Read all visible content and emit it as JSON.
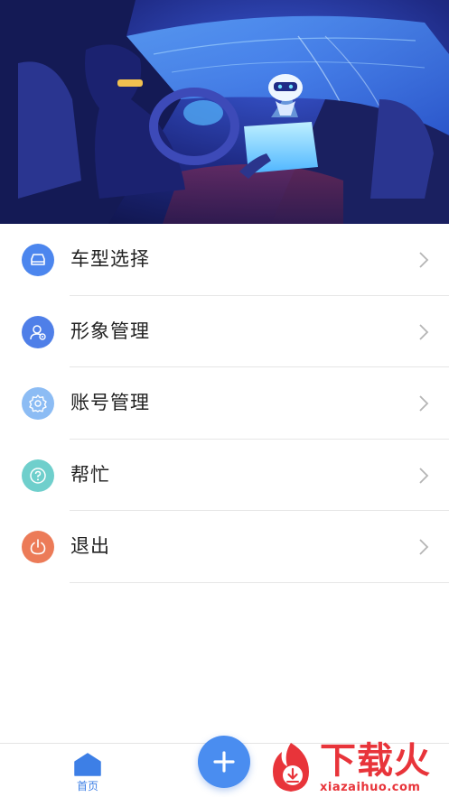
{
  "menu": {
    "items": [
      {
        "label": "车型选择",
        "icon": "car-icon",
        "color": "#4c86ee"
      },
      {
        "label": "形象管理",
        "icon": "avatar-settings-icon",
        "color": "#4f7fe8"
      },
      {
        "label": "账号管理",
        "icon": "gear-icon",
        "color": "#8cbcf4"
      },
      {
        "label": "帮忙",
        "icon": "help-icon",
        "color": "#6fcfcc"
      },
      {
        "label": "退出",
        "icon": "power-icon",
        "color": "#ec7b58"
      }
    ]
  },
  "tabbar": {
    "home_label": "首页",
    "home_icon": "home-icon",
    "fab_icon": "plus-icon",
    "accent_color": "#3d7fe6"
  },
  "watermark": {
    "brand": "下载火",
    "domain": "xiazaihuo.com",
    "color": "#e8343a"
  }
}
